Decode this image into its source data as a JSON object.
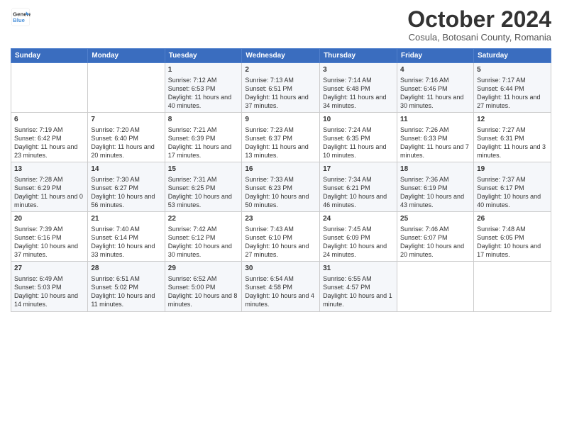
{
  "header": {
    "logo_line1": "General",
    "logo_line2": "Blue",
    "month": "October 2024",
    "location": "Cosula, Botosani County, Romania"
  },
  "weekdays": [
    "Sunday",
    "Monday",
    "Tuesday",
    "Wednesday",
    "Thursday",
    "Friday",
    "Saturday"
  ],
  "weeks": [
    [
      {
        "day": "",
        "info": ""
      },
      {
        "day": "",
        "info": ""
      },
      {
        "day": "1",
        "info": "Sunrise: 7:12 AM\nSunset: 6:53 PM\nDaylight: 11 hours and 40 minutes."
      },
      {
        "day": "2",
        "info": "Sunrise: 7:13 AM\nSunset: 6:51 PM\nDaylight: 11 hours and 37 minutes."
      },
      {
        "day": "3",
        "info": "Sunrise: 7:14 AM\nSunset: 6:48 PM\nDaylight: 11 hours and 34 minutes."
      },
      {
        "day": "4",
        "info": "Sunrise: 7:16 AM\nSunset: 6:46 PM\nDaylight: 11 hours and 30 minutes."
      },
      {
        "day": "5",
        "info": "Sunrise: 7:17 AM\nSunset: 6:44 PM\nDaylight: 11 hours and 27 minutes."
      }
    ],
    [
      {
        "day": "6",
        "info": "Sunrise: 7:19 AM\nSunset: 6:42 PM\nDaylight: 11 hours and 23 minutes."
      },
      {
        "day": "7",
        "info": "Sunrise: 7:20 AM\nSunset: 6:40 PM\nDaylight: 11 hours and 20 minutes."
      },
      {
        "day": "8",
        "info": "Sunrise: 7:21 AM\nSunset: 6:39 PM\nDaylight: 11 hours and 17 minutes."
      },
      {
        "day": "9",
        "info": "Sunrise: 7:23 AM\nSunset: 6:37 PM\nDaylight: 11 hours and 13 minutes."
      },
      {
        "day": "10",
        "info": "Sunrise: 7:24 AM\nSunset: 6:35 PM\nDaylight: 11 hours and 10 minutes."
      },
      {
        "day": "11",
        "info": "Sunrise: 7:26 AM\nSunset: 6:33 PM\nDaylight: 11 hours and 7 minutes."
      },
      {
        "day": "12",
        "info": "Sunrise: 7:27 AM\nSunset: 6:31 PM\nDaylight: 11 hours and 3 minutes."
      }
    ],
    [
      {
        "day": "13",
        "info": "Sunrise: 7:28 AM\nSunset: 6:29 PM\nDaylight: 11 hours and 0 minutes."
      },
      {
        "day": "14",
        "info": "Sunrise: 7:30 AM\nSunset: 6:27 PM\nDaylight: 10 hours and 56 minutes."
      },
      {
        "day": "15",
        "info": "Sunrise: 7:31 AM\nSunset: 6:25 PM\nDaylight: 10 hours and 53 minutes."
      },
      {
        "day": "16",
        "info": "Sunrise: 7:33 AM\nSunset: 6:23 PM\nDaylight: 10 hours and 50 minutes."
      },
      {
        "day": "17",
        "info": "Sunrise: 7:34 AM\nSunset: 6:21 PM\nDaylight: 10 hours and 46 minutes."
      },
      {
        "day": "18",
        "info": "Sunrise: 7:36 AM\nSunset: 6:19 PM\nDaylight: 10 hours and 43 minutes."
      },
      {
        "day": "19",
        "info": "Sunrise: 7:37 AM\nSunset: 6:17 PM\nDaylight: 10 hours and 40 minutes."
      }
    ],
    [
      {
        "day": "20",
        "info": "Sunrise: 7:39 AM\nSunset: 6:16 PM\nDaylight: 10 hours and 37 minutes."
      },
      {
        "day": "21",
        "info": "Sunrise: 7:40 AM\nSunset: 6:14 PM\nDaylight: 10 hours and 33 minutes."
      },
      {
        "day": "22",
        "info": "Sunrise: 7:42 AM\nSunset: 6:12 PM\nDaylight: 10 hours and 30 minutes."
      },
      {
        "day": "23",
        "info": "Sunrise: 7:43 AM\nSunset: 6:10 PM\nDaylight: 10 hours and 27 minutes."
      },
      {
        "day": "24",
        "info": "Sunrise: 7:45 AM\nSunset: 6:09 PM\nDaylight: 10 hours and 24 minutes."
      },
      {
        "day": "25",
        "info": "Sunrise: 7:46 AM\nSunset: 6:07 PM\nDaylight: 10 hours and 20 minutes."
      },
      {
        "day": "26",
        "info": "Sunrise: 7:48 AM\nSunset: 6:05 PM\nDaylight: 10 hours and 17 minutes."
      }
    ],
    [
      {
        "day": "27",
        "info": "Sunrise: 6:49 AM\nSunset: 5:03 PM\nDaylight: 10 hours and 14 minutes."
      },
      {
        "day": "28",
        "info": "Sunrise: 6:51 AM\nSunset: 5:02 PM\nDaylight: 10 hours and 11 minutes."
      },
      {
        "day": "29",
        "info": "Sunrise: 6:52 AM\nSunset: 5:00 PM\nDaylight: 10 hours and 8 minutes."
      },
      {
        "day": "30",
        "info": "Sunrise: 6:54 AM\nSunset: 4:58 PM\nDaylight: 10 hours and 4 minutes."
      },
      {
        "day": "31",
        "info": "Sunrise: 6:55 AM\nSunset: 4:57 PM\nDaylight: 10 hours and 1 minute."
      },
      {
        "day": "",
        "info": ""
      },
      {
        "day": "",
        "info": ""
      }
    ]
  ]
}
